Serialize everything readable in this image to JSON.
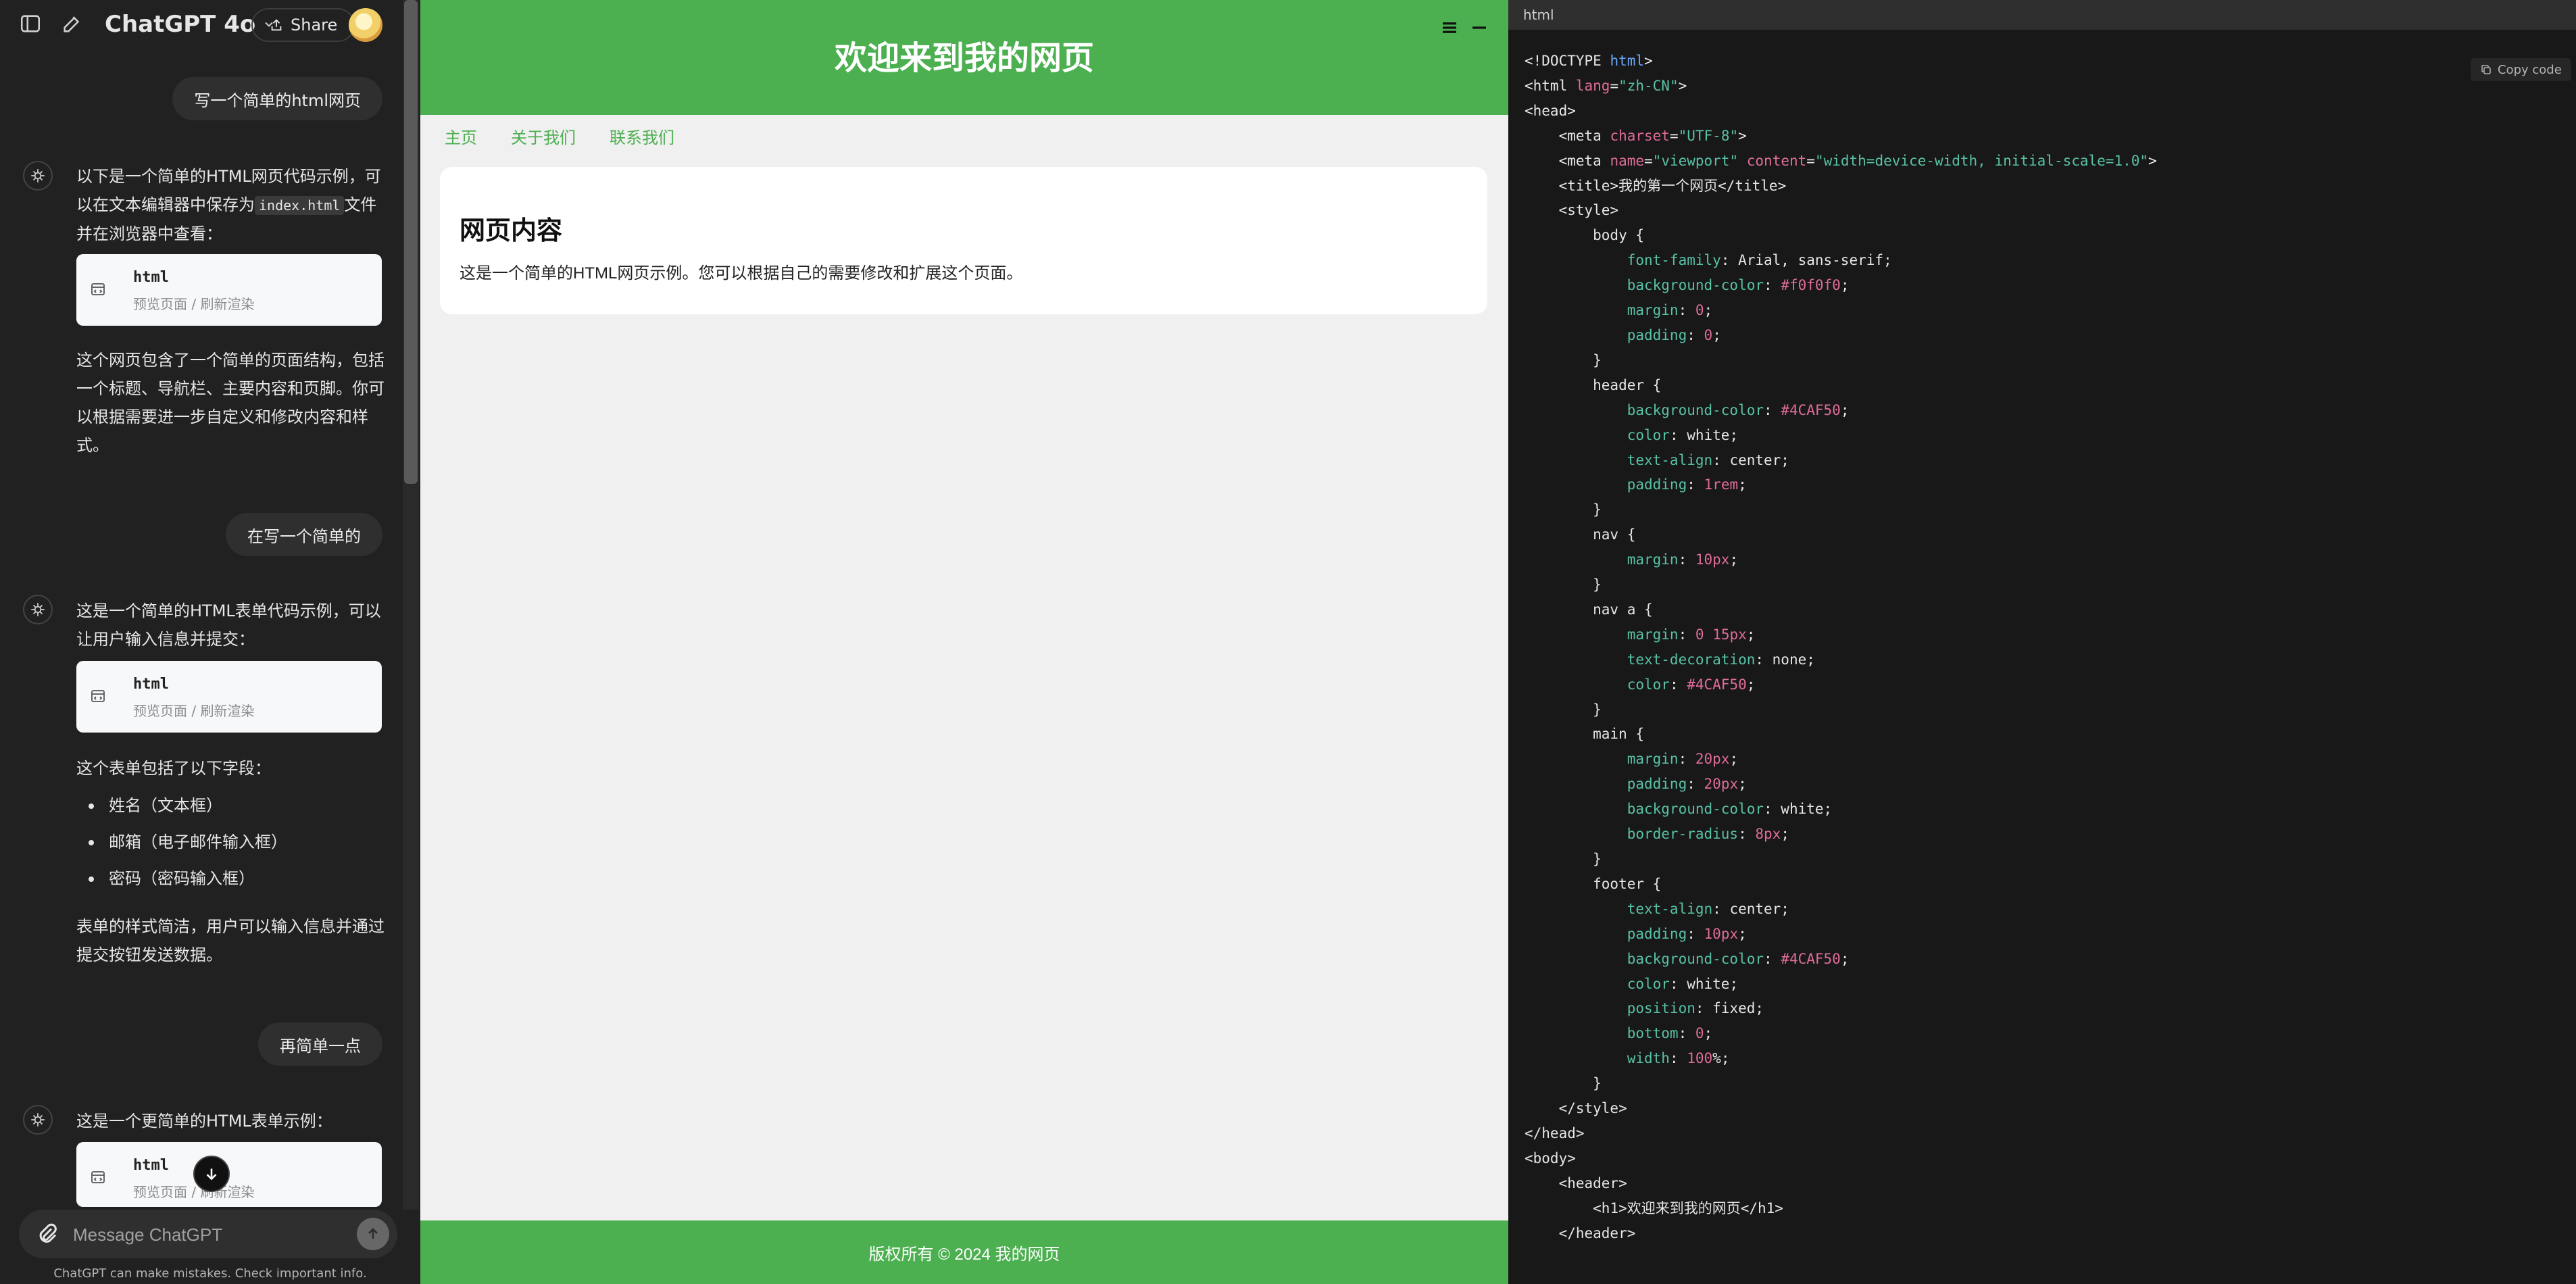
{
  "chat": {
    "header": {
      "model": "ChatGPT 4o",
      "share_label": "Share"
    },
    "messages": [
      {
        "role": "user",
        "text": "写一个简单的html网页"
      },
      {
        "role": "assistant",
        "intro_before": "以下是一个简单的HTML网页代码示例，可以在文本编辑器中保存为",
        "intro_code": "index.html",
        "intro_after": "文件并在浏览器中查看：",
        "card_title": "html",
        "card_sub": "预览页面 / 刷新渲染",
        "after": "这个网页包含了一个简单的页面结构，包括一个标题、导航栏、主要内容和页脚。你可以根据需要进一步自定义和修改内容和样式。"
      },
      {
        "role": "user",
        "text": "在写一个简单的"
      },
      {
        "role": "assistant",
        "intro": "这是一个简单的HTML表单代码示例，可以让用户输入信息并提交：",
        "card_title": "html",
        "card_sub": "预览页面 / 刷新渲染",
        "list_intro": "这个表单包括了以下字段：",
        "list": [
          "姓名（文本框）",
          "邮箱（电子邮件输入框）",
          "密码（密码输入框）"
        ],
        "after": "表单的样式简洁，用户可以输入信息并通过提交按钮发送数据。"
      },
      {
        "role": "user",
        "text": "再简单一点"
      },
      {
        "role": "assistant",
        "intro": "这是一个更简单的HTML表单示例：",
        "card_title": "html",
        "card_sub": "预览页面 / 刷新渲染"
      }
    ],
    "input_placeholder": "Message ChatGPT",
    "disclaimer": "ChatGPT can make mistakes. Check important info."
  },
  "preview": {
    "title": "欢迎来到我的网页",
    "nav": [
      "主页",
      "关于我们",
      "联系我们"
    ],
    "main_heading": "网页内容",
    "main_text": "这是一个简单的HTML网页示例。您可以根据自己的需要修改和扩展这个页面。",
    "footer": "版权所有 © 2024 我的网页"
  },
  "code": {
    "language": "html",
    "copy_label": "Copy code",
    "lines": [
      "<!DOCTYPE html>",
      "<html lang=\"zh-CN\">",
      "<head>",
      "    <meta charset=\"UTF-8\">",
      "    <meta name=\"viewport\" content=\"width=device-width, initial-scale=1.0\">",
      "    <title>我的第一个网页</title>",
      "    <style>",
      "        body {",
      "            font-family: Arial, sans-serif;",
      "            background-color: #f0f0f0;",
      "            margin: 0;",
      "            padding: 0;",
      "        }",
      "        header {",
      "            background-color: #4CAF50;",
      "            color: white;",
      "            text-align: center;",
      "            padding: 1rem;",
      "        }",
      "        nav {",
      "            margin: 10px;",
      "        }",
      "        nav a {",
      "            margin: 0 15px;",
      "            text-decoration: none;",
      "            color: #4CAF50;",
      "        }",
      "        main {",
      "            margin: 20px;",
      "            padding: 20px;",
      "            background-color: white;",
      "            border-radius: 8px;",
      "        }",
      "        footer {",
      "            text-align: center;",
      "            padding: 10px;",
      "            background-color: #4CAF50;",
      "            color: white;",
      "            position: fixed;",
      "            bottom: 0;",
      "            width: 100%;",
      "        }",
      "    </style>",
      "</head>",
      "<body>",
      "    <header>",
      "        <h1>欢迎来到我的网页</h1>",
      "    </header>"
    ]
  }
}
